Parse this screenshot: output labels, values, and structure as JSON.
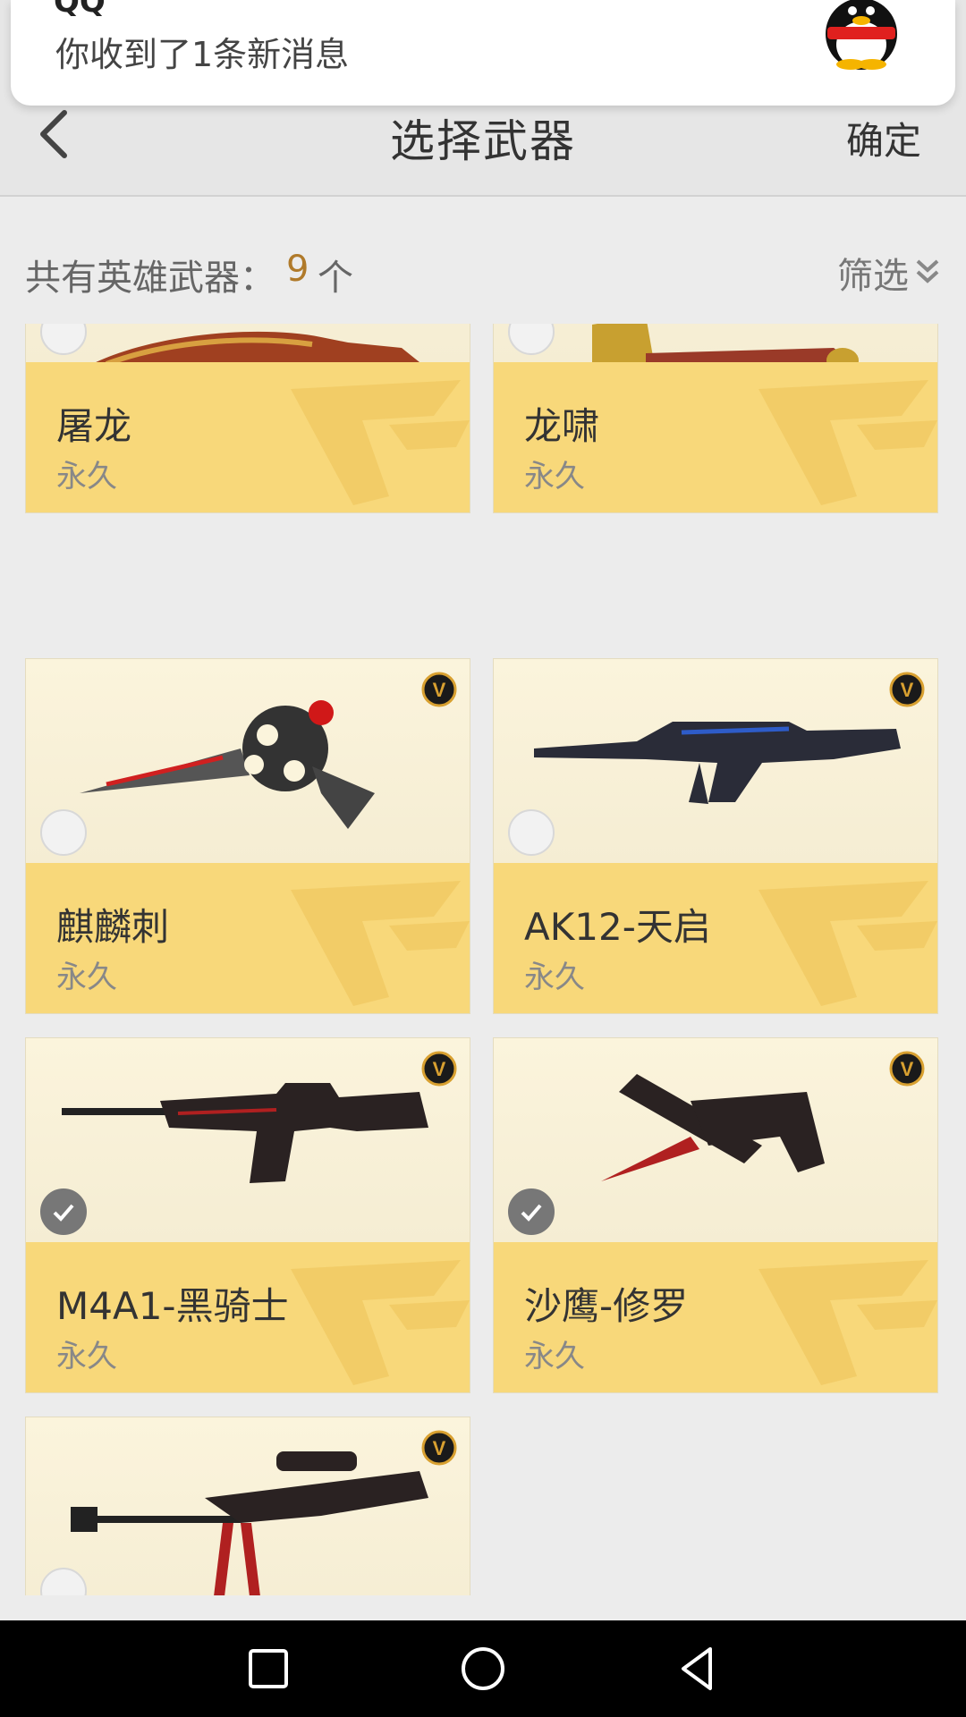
{
  "notification": {
    "app": "QQ",
    "message": "你收到了1条新消息",
    "avatar_icon": "qq-penguin-icon"
  },
  "header": {
    "title": "选择武器",
    "confirm_label": "确定",
    "back_icon": "chevron-left-icon"
  },
  "summary": {
    "label": "共有英雄武器：",
    "count": "9",
    "unit": "个",
    "filter_label": "筛选",
    "filter_icon": "double-chevron-down-icon"
  },
  "weapons": [
    {
      "name": "屠龙",
      "term": "永久",
      "selected": false,
      "weapon_type": "curved-knife"
    },
    {
      "name": "龙啸",
      "term": "永久",
      "selected": false,
      "weapon_type": "axe"
    },
    {
      "name": "麒麟刺",
      "term": "永久",
      "selected": false,
      "weapon_type": "knuckle-blade"
    },
    {
      "name": "AK12-天启",
      "term": "永久",
      "selected": false,
      "weapon_type": "rifle"
    },
    {
      "name": "M4A1-黑骑士",
      "term": "永久",
      "selected": true,
      "weapon_type": "rifle"
    },
    {
      "name": "沙鹰-修罗",
      "term": "永久",
      "selected": true,
      "weapon_type": "pistol-blade"
    },
    {
      "name": "",
      "term": "",
      "selected": false,
      "weapon_type": "sniper-rifle"
    }
  ],
  "colors": {
    "card_info_bg": "#f8d87a",
    "count_color": "#b07a2a",
    "check_on": "#777777"
  },
  "navbar": {
    "recent_icon": "square-icon",
    "home_icon": "circle-icon",
    "back_icon": "triangle-back-icon"
  }
}
